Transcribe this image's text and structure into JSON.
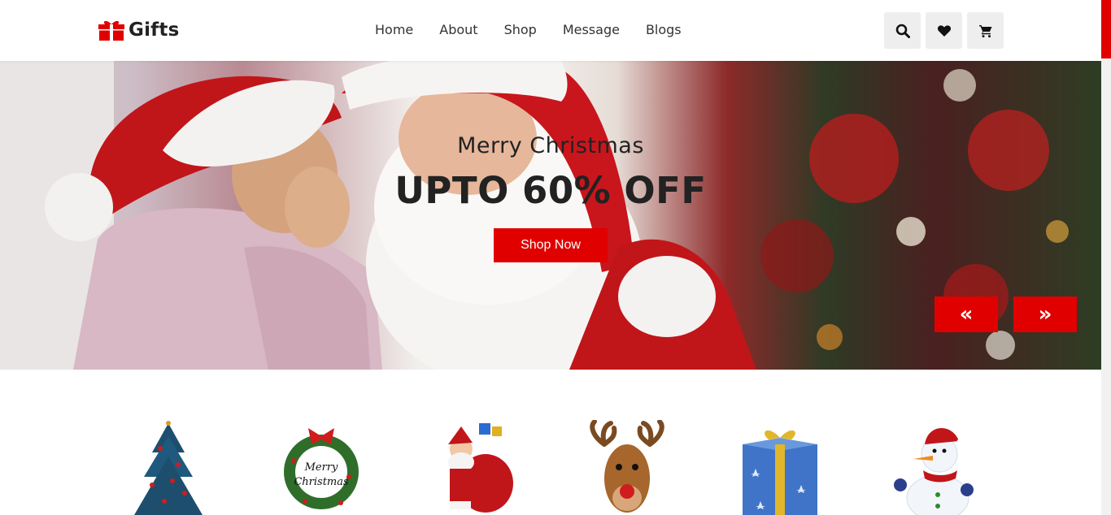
{
  "header": {
    "logo_text": "Gifts",
    "logo_icon": "gift-icon",
    "nav": [
      "Home",
      "About",
      "Shop",
      "Message",
      "Blogs"
    ],
    "actions": [
      {
        "name": "search-icon"
      },
      {
        "name": "heart-icon"
      },
      {
        "name": "cart-icon"
      }
    ]
  },
  "hero": {
    "subtitle": "Merry Christmas",
    "title": "UPTO 60% OFF",
    "cta": "Shop Now",
    "prev_label": "«",
    "next_label": "»"
  },
  "categories": [
    {
      "name": "christmas-tree-icon"
    },
    {
      "name": "merry-christmas-wreath-icon"
    },
    {
      "name": "santa-icon"
    },
    {
      "name": "reindeer-icon"
    },
    {
      "name": "gift-box-icon"
    },
    {
      "name": "snowman-icon"
    }
  ],
  "colors": {
    "accent": "#e00000",
    "button_bg": "#eeeeee"
  }
}
